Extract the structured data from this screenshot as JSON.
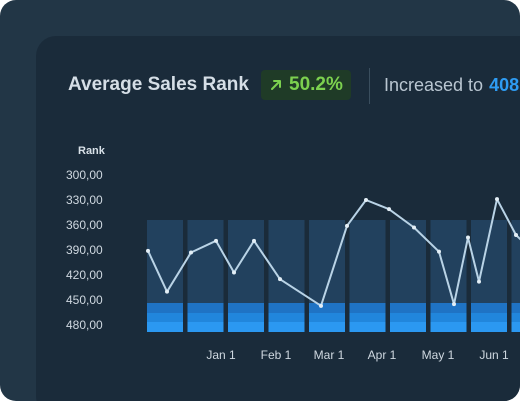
{
  "header": {
    "title": "Average Sales Rank",
    "change_pct": "50.2%",
    "increased_label": "Increased to",
    "increased_value": "408"
  },
  "colors": {
    "background_outer": "#223646",
    "card": "#1a2b3a",
    "positive": "#7cd14f",
    "accent_blue": "#2e9cf3",
    "column": "#22415e",
    "line": "#b9d3e6"
  },
  "icons": {
    "badge_icon": "arrow-up-right-icon"
  },
  "chart_data": {
    "type": "line",
    "ylabel": "Rank",
    "y_ticks": [
      "300,00",
      "330,00",
      "360,00",
      "390,00",
      "420,00",
      "450,00",
      "480,00"
    ],
    "x_ticks": [
      "Jan 1",
      "Feb 1",
      "Mar 1",
      "Apr 1",
      "May 1",
      "Jun 1"
    ],
    "ylim": [
      300,
      480
    ],
    "y_inverted": true,
    "grid": false,
    "series": [
      {
        "values": [
          391,
          440,
          393,
          379,
          417,
          379,
          425,
          457,
          361,
          330,
          341,
          363,
          392,
          455,
          375,
          428,
          329,
          372,
          395
        ]
      }
    ]
  }
}
